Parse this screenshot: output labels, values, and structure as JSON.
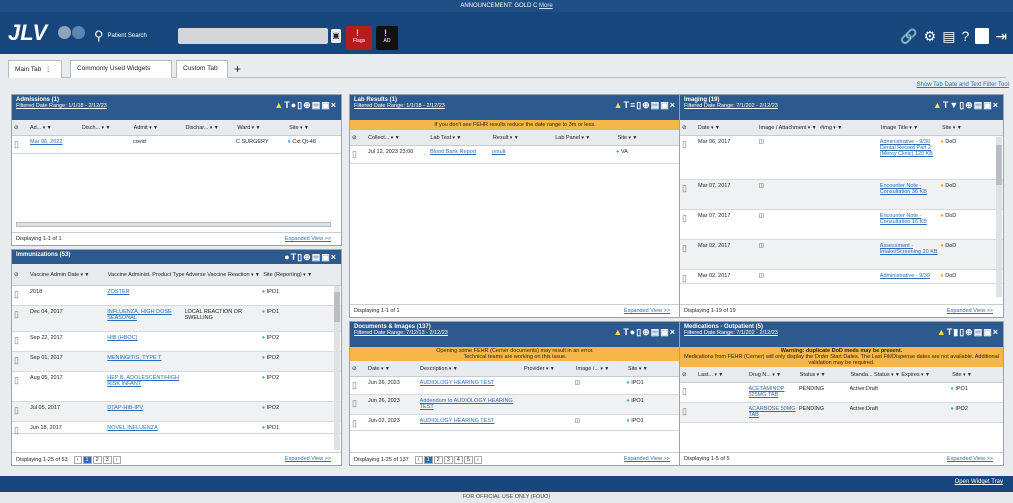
{
  "announcement": {
    "text": "ANNOUNCEMENT: GOLD C",
    "link": "More"
  },
  "header": {
    "logo": "JLV",
    "patient_search": "Patient Search",
    "flags_label": "Flags",
    "ad_label": "AD"
  },
  "tabs": [
    {
      "label": "Main Tab"
    },
    {
      "label": "Commonly Used Widgets"
    },
    {
      "label": "Custom Tab"
    }
  ],
  "tools_link": "Show Tab Date and Text Filter Tool",
  "admissions": {
    "title": "Admissions (1)",
    "filter": "Filtered Date Range: 1/1/18 - 2/12/23",
    "cols": [
      "Ad...",
      "Disch...",
      "Admit",
      "Dischar...",
      "Ward",
      "Site"
    ],
    "rows": [
      [
        "Mar 06, 2022",
        "",
        "covid",
        "",
        "C SURGERY",
        "Cxt Qt-48"
      ]
    ],
    "footer": "Displaying 1-1 of 1",
    "expanded": "Expanded View >>"
  },
  "labs": {
    "title": "Lab Results (1)",
    "filter": "Filtered Date Range: 1/1/18 - 2/12/23",
    "note": "If you don't see FEHR results reduce the date range to 3m or less.",
    "cols": [
      "Collect...",
      "Lab Test",
      "Result",
      "Lab Panel",
      "Site"
    ],
    "rows": [
      [
        "Jul 12, 2023 23:00",
        "Blood Bank Report",
        "result",
        "",
        "VA"
      ]
    ],
    "footer": "Displaying 1-1 of 1",
    "expanded": "Expanded View >>"
  },
  "imaging": {
    "title": "Imaging (19)",
    "filter": "Filtered Date Range: 7/1/202 - 2/12/23",
    "cols": [
      "Date",
      "Image / Attachment",
      "#img",
      "Image Title",
      "Site"
    ],
    "rows": [
      [
        "Mar 06, 2017",
        "Administrative - 9/30 Dental Record Part 2 (Mercy Clinic) 120 KB",
        "DoD"
      ],
      [
        "Mar 07, 2017",
        "Encounter Note - Consultation 36 KB",
        "DoD"
      ],
      [
        "Mar 07, 2017",
        "Encounter Note - Consultation 16 KB",
        "DoD"
      ],
      [
        "Mar 02, 2017",
        "Assessment - Intake/Screening 20 KB",
        "DoD"
      ],
      [
        "Mar 02, 2017",
        "Administrative - 9/30",
        "DoD"
      ]
    ],
    "footer": "Displaying 1-19 of 19",
    "expanded": "Expanded View >>"
  },
  "immunizations": {
    "title": "Immunizations (53)",
    "cols": [
      "Vaccine Admin Date",
      "Vaccine Administ. Product Type",
      "Adverse Vaccine Reaction",
      "Site (Reporting)"
    ],
    "rows": [
      [
        "2018",
        "ZOSTER",
        "",
        "IPO1"
      ],
      [
        "Dec 04, 2017",
        "INFLUENZA, HIGH DOSE SEASONAL",
        "LOCAL REACTION OR SWELLING",
        "IPO1"
      ],
      [
        "Sep 22, 2017",
        "HIB (HBOC)",
        "",
        "IPO2"
      ],
      [
        "Sep 01, 2017",
        "MENINGITIS, TYPE T",
        "",
        "IPO2"
      ],
      [
        "Aug 05, 2017",
        "HEP B, ADOLESCENT/HIGH RISK INFANT",
        "",
        "IPO2"
      ],
      [
        "Jul 05, 2017",
        "DTAP-HIB-IPV",
        "",
        "IPO2"
      ],
      [
        "Jun 18, 2017",
        "NOVEL INFLUENZA",
        "",
        "IPO1"
      ]
    ],
    "footer": "Displaying 1-25 of 53",
    "pages": [
      "1",
      "2",
      "3"
    ],
    "expanded": "Expanded View >>"
  },
  "documents": {
    "title": "Documents & Images (137)",
    "filter": "Filtered Date Range: 7/12/13 - 2/12/23",
    "note1": "Opening some FEHR (Cerner documents) may result in an error.",
    "note2": "Technical teams are working on this issue.",
    "cols": [
      "Date",
      "Description",
      "Provider",
      "Image /...",
      "Site"
    ],
    "rows": [
      [
        "Jun 26, 2023",
        "AUDIOLOGY HEARING TEST",
        "",
        "IPO1"
      ],
      [
        "Jun 26, 2023",
        "Addendum to AUDIOLOGY HEARING TEST",
        "",
        "IPO1"
      ],
      [
        "Jun 02, 2023",
        "AUDIOLOGY HEARING TEST",
        "",
        "IPO1"
      ]
    ],
    "footer": "Displaying 1-25 of 137",
    "pages": [
      "1",
      "2",
      "3",
      "4",
      "5"
    ],
    "expanded": "Expanded View >>"
  },
  "medications": {
    "title": "Medications - Outpatient (5)",
    "filter": "Filtered Date Range: 7/1/202 - 2/12/23",
    "note1": "Warning: duplicate DoD meds may be present.",
    "note2": "Medications from FEHR (Cerner) will only display the Order Start Dates. The Last Fill/Dispense dates are not available. Additional validation may be required.",
    "cols": [
      "Last...",
      "Drug N...",
      "Status",
      "Standa... Status",
      "Expires",
      "Site"
    ],
    "rows": [
      [
        "",
        "ACETAMINOP 325MG TAB",
        "PENDING",
        "Active:Draft",
        "",
        "IPO1"
      ],
      [
        "",
        "ACARBOSE 50MG TAB",
        "PENDING",
        "Active:Draft",
        "",
        "IPO2"
      ]
    ],
    "footer": "Displaying 1-5 of 5",
    "expanded": "Expanded View >>"
  },
  "footer": {
    "open_widget": "Open Widget Tray",
    "fouo": "FOR OFFICIAL USE ONLY (FOUO)"
  }
}
